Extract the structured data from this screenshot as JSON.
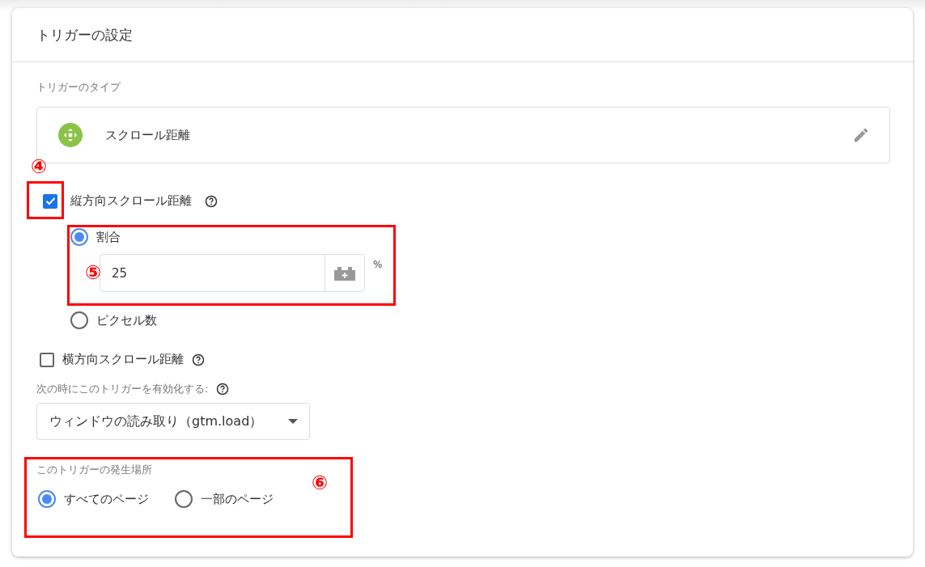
{
  "panel": {
    "title": "トリガーの設定"
  },
  "trigger_type": {
    "label": "トリガーのタイプ",
    "name": "スクロール距離"
  },
  "vertical": {
    "label": "縦方向スクロール距離",
    "checked": true,
    "value": "25",
    "unit": "%",
    "options": [
      {
        "label": "割合",
        "selected": true
      },
      {
        "label": "ピクセル数",
        "selected": false
      }
    ]
  },
  "horizontal": {
    "label": "横方向スクロール距離",
    "checked": false
  },
  "fire_on": {
    "label": "次の時にこのトリガーを有効化する:",
    "value": "ウィンドウの読み取り（gtm.load）"
  },
  "scope": {
    "label": "このトリガーの発生場所",
    "options": [
      {
        "label": "すべてのページ",
        "selected": true
      },
      {
        "label": "一部のページ",
        "selected": false
      }
    ]
  },
  "annotations": [
    {
      "label": "④"
    },
    {
      "label": "⑤"
    },
    {
      "label": "⑥"
    }
  ]
}
